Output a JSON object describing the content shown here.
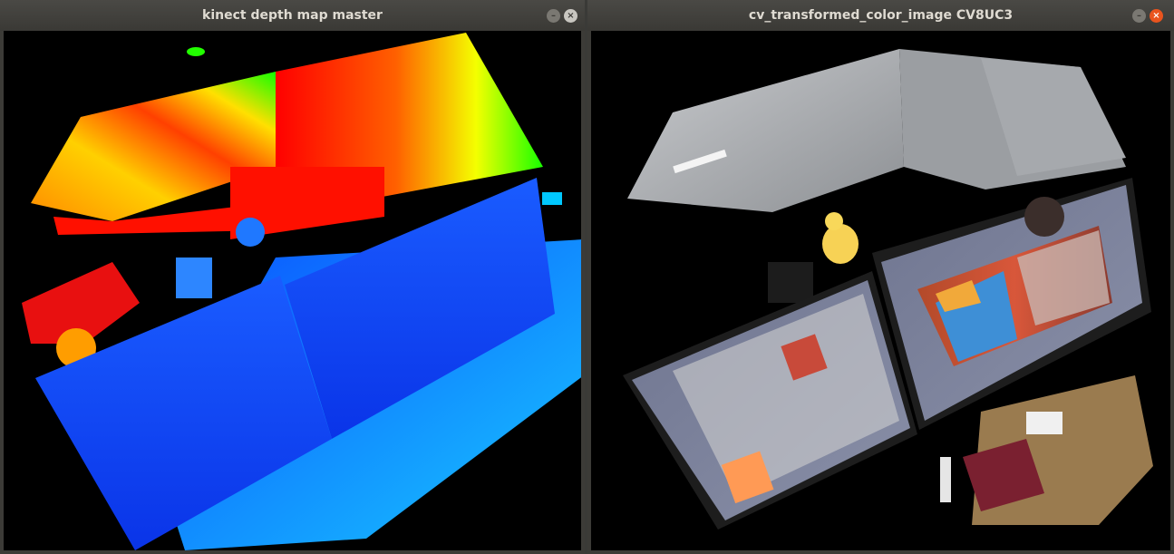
{
  "windows": [
    {
      "title": "kinect depth map master",
      "buttons": {
        "minimize": "–",
        "close": "×"
      },
      "image_label": "depth-map"
    },
    {
      "title": "cv_transformed_color_image CV8UC3",
      "buttons": {
        "minimize": "–",
        "close": "×"
      },
      "image_label": "color-image"
    }
  ],
  "colors": {
    "titlebar": "#3c3b37",
    "close_active": "#e9541e",
    "depth_far": "#ff0000",
    "depth_mid": "#ffff00",
    "depth_near": "#0a3cf0"
  }
}
